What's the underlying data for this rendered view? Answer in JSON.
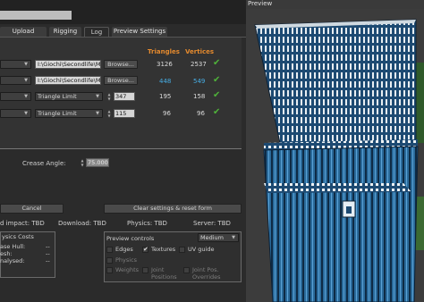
{
  "tabs": [
    {
      "label": "Upload options"
    },
    {
      "label": "Rigging"
    },
    {
      "label": "Log"
    },
    {
      "label": "Preview Settings"
    }
  ],
  "columns": {
    "triangles": "Triangles",
    "vertices": "Vertices"
  },
  "rows": [
    {
      "path": "I:\\Giochi\\Secondlife\\Mo",
      "browse": "Browse...",
      "triangles": "3126",
      "vertices": "2537",
      "highlight": false
    },
    {
      "path": "I:\\Giochi\\Secondlife\\Mo",
      "browse": "Browse...",
      "triangles": "448",
      "vertices": "549",
      "highlight": true
    },
    {
      "method": "Triangle Limit",
      "limit": "347",
      "triangles": "195",
      "vertices": "158",
      "highlight": false
    },
    {
      "method": "Triangle Limit",
      "limit": "115",
      "triangles": "96",
      "vertices": "96",
      "highlight": false
    }
  ],
  "crease": {
    "label": "Crease Angle:",
    "value": "75.000"
  },
  "buttons": {
    "cancel": "Cancel",
    "clear": "Clear settings & reset form"
  },
  "status": {
    "impact": "d impact: TBD",
    "download": "Download: TBD",
    "physics": "Physics: TBD",
    "server": "Server: TBD"
  },
  "physics_costs": {
    "title": "ysics Costs",
    "rows": [
      {
        "label": "ase Hull:",
        "value": "--"
      },
      {
        "label": "esh:",
        "value": "--"
      },
      {
        "label": "nalysed:",
        "value": "--"
      }
    ]
  },
  "preview_controls": {
    "title": "Preview controls",
    "quality": "Medium",
    "options": [
      {
        "label": "Edges",
        "checked": false,
        "enabled": true
      },
      {
        "label": "Textures",
        "checked": true,
        "enabled": true
      },
      {
        "label": "UV guide",
        "checked": false,
        "enabled": true
      },
      {
        "label": "Physics",
        "checked": false,
        "enabled": false
      },
      {
        "label": "Weights",
        "checked": false,
        "enabled": false
      },
      {
        "label": "Joint Positions",
        "checked": false,
        "enabled": false
      },
      {
        "label": "Joint Pos. Overrides",
        "checked": false,
        "enabled": false
      }
    ]
  },
  "preview": {
    "title": "Preview"
  },
  "colors": {
    "accent": "#e48a2e",
    "blue": "#47aee5",
    "check": "#4fb23a"
  }
}
